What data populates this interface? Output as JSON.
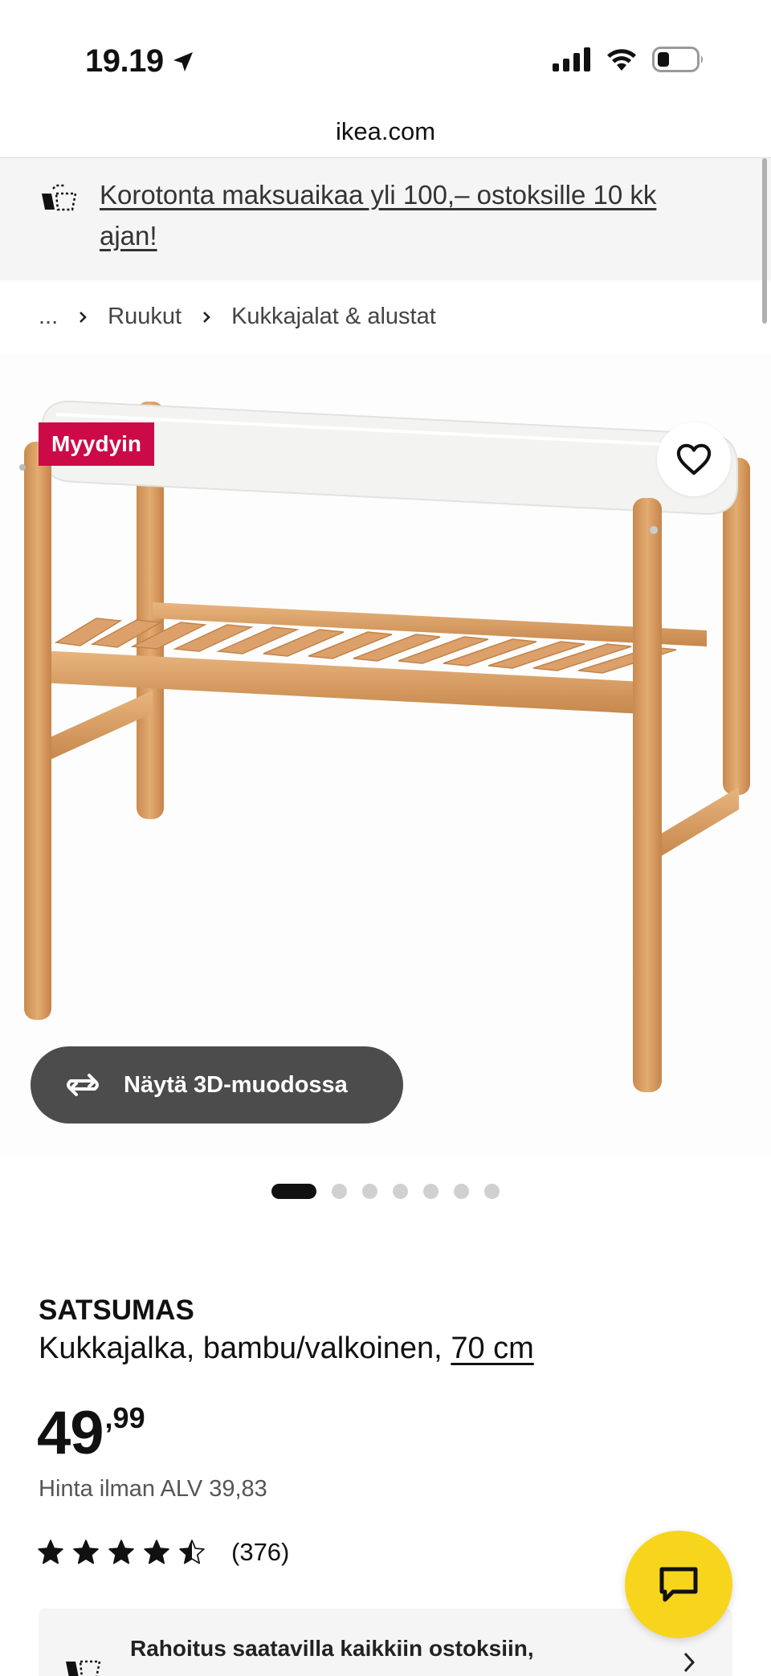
{
  "status_bar": {
    "time": "19.19"
  },
  "browser": {
    "url": "ikea.com"
  },
  "promo": {
    "text": "Korotonta maksuaikaa yli 100,– ostoksille 10 kk ajan!"
  },
  "breadcrumb": {
    "ellipsis": "...",
    "items": [
      "Ruukut",
      "Kukkajalat & alustat"
    ]
  },
  "product": {
    "badge": "Myydyin",
    "view_3d_label": "Näytä 3D-muodossa",
    "carousel": {
      "total": 7,
      "active": 1
    },
    "name": "SATSUMAS",
    "description": "Kukkajalka, bambu/valkoinen,",
    "size": "70 cm",
    "price": {
      "integer": "49",
      "decimal": ",99"
    },
    "price_without_vat": "Hinta ilman ALV 39,83",
    "rating": {
      "stars": 4.5,
      "count": "(376)"
    }
  },
  "financing": {
    "text": "Rahoitus saatavilla kaikkiin ostoksiin,"
  },
  "colors": {
    "badge": "#cc0a47",
    "chat": "#f7d51c",
    "button_3d": "#4c4c4c",
    "wood": "#d9a066",
    "tray": "#f4f4f2"
  },
  "icons": [
    "location-arrow-icon",
    "signal-icon",
    "wifi-icon",
    "battery-icon",
    "cart-clock-icon",
    "chevron-right-icon",
    "heart-icon",
    "rotate-3d-icon",
    "star-icon",
    "chat-icon"
  ]
}
